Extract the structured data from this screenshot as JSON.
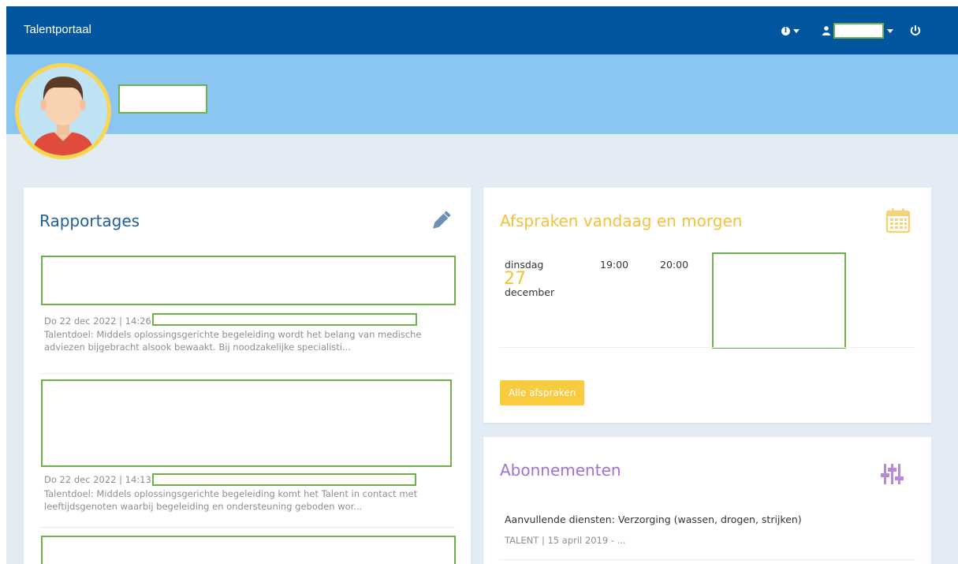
{
  "navbar": {
    "brand": "Talentportaal",
    "info_icon": "info-circle-icon",
    "user_icon": "user-icon",
    "power_icon": "power-icon",
    "bg_color": "#02569f"
  },
  "hero": {
    "bg_color": "#8ac6f1",
    "avatar_ring_color": "#f9d64d"
  },
  "rapportages": {
    "title": "Rapportages",
    "edit_icon": "pencil-icon",
    "items": [
      {
        "date": "Do 22 dec 2022 | 14:26 |",
        "summary": "Talentdoel: Middels oplossingsgerichte begeleiding wordt het belang van medische adviezen bijgebracht alsook bewaakt. Bij noodzakelijke specialisti..."
      },
      {
        "date": "Do 22 dec 2022 | 14:13 |",
        "summary": "Talentdoel: Middels oplossingsgerichte begeleiding komt het Talent in contact met leeftijdsgenoten waarbij begeleiding en ondersteuning geboden wor..."
      }
    ]
  },
  "afspraken": {
    "title": "Afspraken vandaag en morgen",
    "calendar_icon": "calendar-icon",
    "appointment": {
      "weekday": "dinsdag",
      "day": "27",
      "month": "december",
      "start": "19:00",
      "end": "20:00"
    },
    "button_label": "Alle afspraken"
  },
  "abonnementen": {
    "title": "Abonnementen",
    "settings_icon": "sliders-icon",
    "items": [
      {
        "title": "Aanvullende diensten: Verzorging (wassen, drogen, strijken)",
        "meta": "TALENT | 15 april 2019 - ..."
      }
    ]
  }
}
